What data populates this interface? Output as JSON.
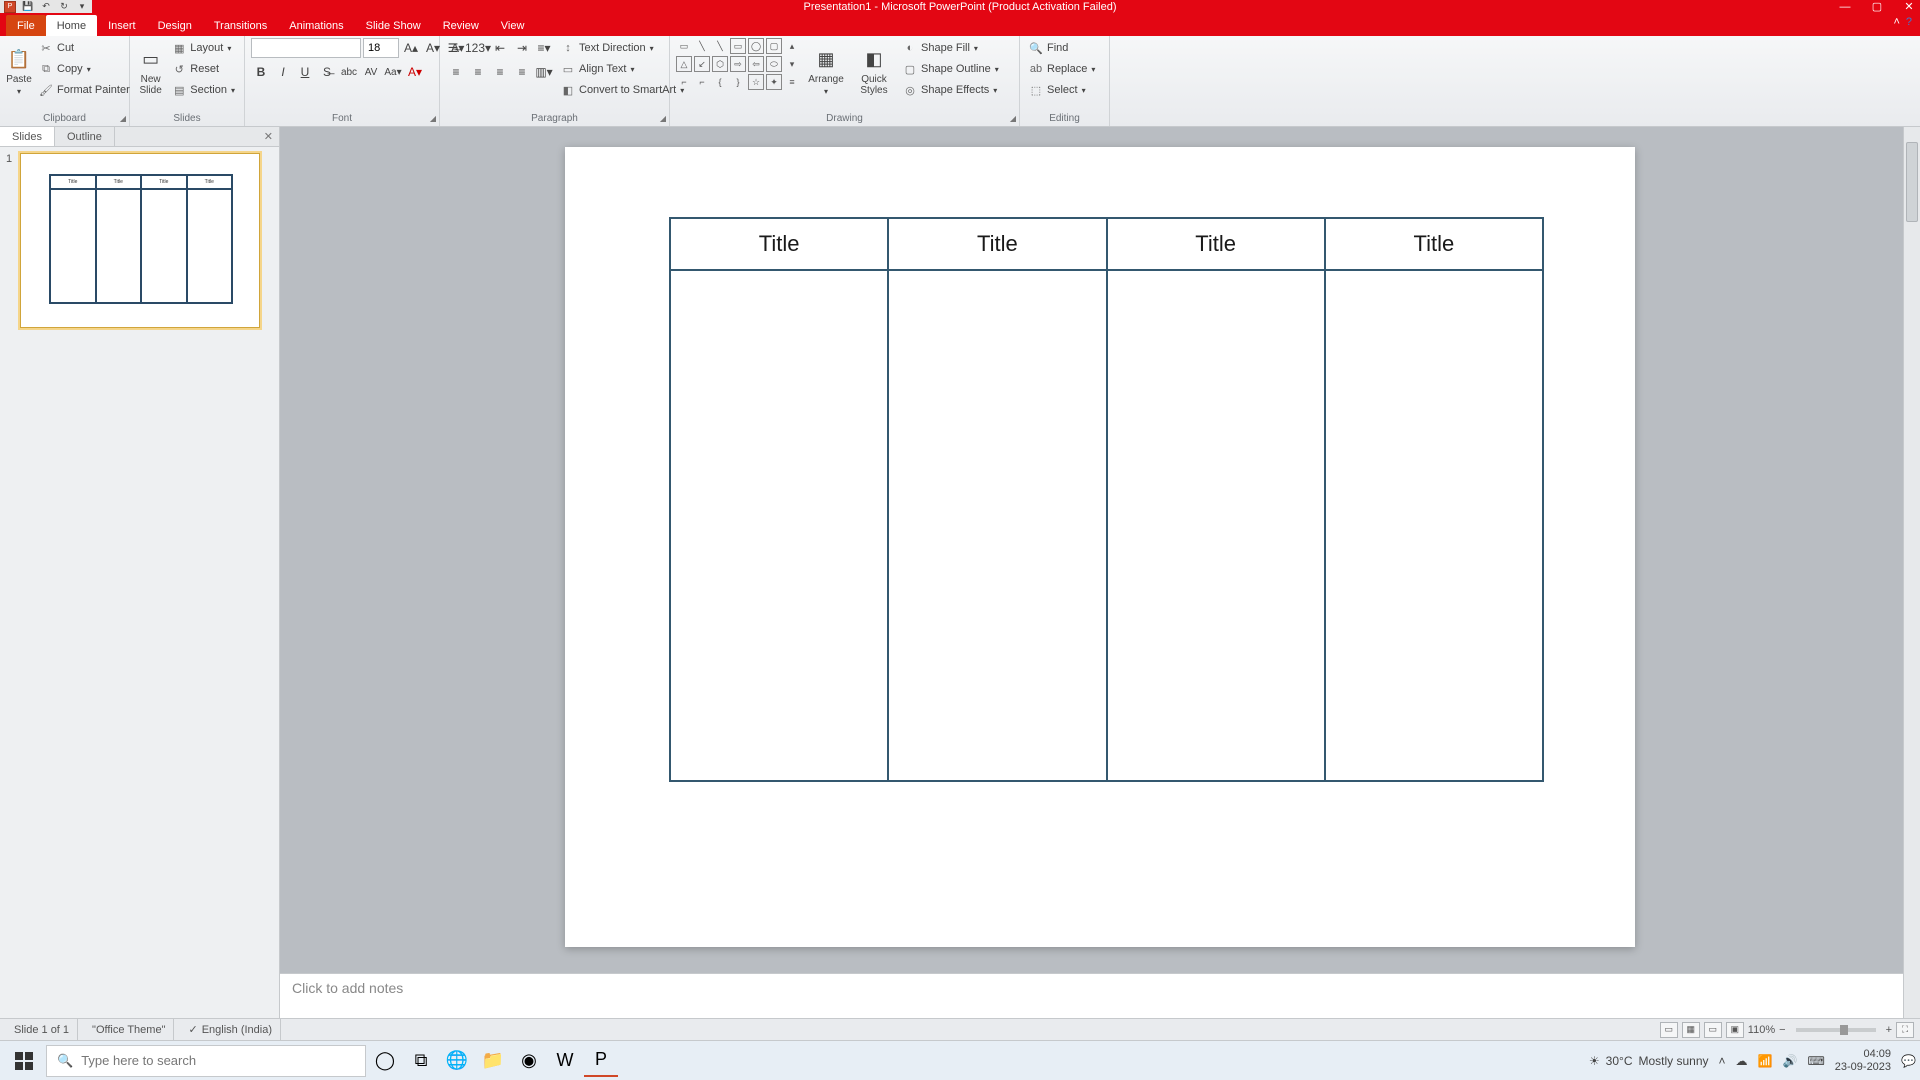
{
  "title": "Presentation1 - Microsoft PowerPoint (Product Activation Failed)",
  "tabs": {
    "file": "File",
    "home": "Home",
    "insert": "Insert",
    "design": "Design",
    "transitions": "Transitions",
    "animations": "Animations",
    "slideshow": "Slide Show",
    "review": "Review",
    "view": "View"
  },
  "clipboard": {
    "paste": "Paste",
    "cut": "Cut",
    "copy": "Copy",
    "format_painter": "Format Painter",
    "label": "Clipboard"
  },
  "slides": {
    "new_slide": "New\nSlide",
    "layout": "Layout",
    "reset": "Reset",
    "section": "Section",
    "label": "Slides"
  },
  "font": {
    "size": "18",
    "label": "Font"
  },
  "paragraph": {
    "text_direction": "Text Direction",
    "align_text": "Align Text",
    "convert": "Convert to SmartArt",
    "label": "Paragraph"
  },
  "drawing": {
    "arrange": "Arrange",
    "quick_styles": "Quick\nStyles",
    "shape_fill": "Shape Fill",
    "shape_outline": "Shape Outline",
    "shape_effects": "Shape Effects",
    "label": "Drawing"
  },
  "editing": {
    "find": "Find",
    "replace": "Replace",
    "select": "Select",
    "label": "Editing"
  },
  "thumb": {
    "slides": "Slides",
    "outline": "Outline",
    "num": "1"
  },
  "table_headers": [
    "Title",
    "Title",
    "Title",
    "Title"
  ],
  "notes_placeholder": "Click to add notes",
  "status": {
    "slide": "Slide 1 of 1",
    "theme": "\"Office Theme\"",
    "lang": "English (India)",
    "zoom": "110%"
  },
  "taskbar": {
    "search": "Type here to search",
    "temp": "30°C",
    "weather": "Mostly sunny",
    "time": "04:09",
    "date": "23-09-2023"
  }
}
